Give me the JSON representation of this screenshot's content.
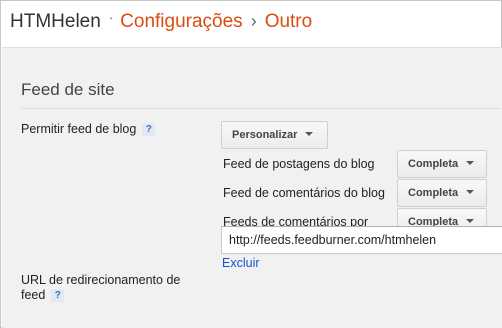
{
  "breadcrumb": {
    "blog_name": "HTMHelen",
    "separator_dot": "·",
    "section": "Configurações",
    "arrow": "›",
    "page": "Outro"
  },
  "feed_section": {
    "title": "Feed de site",
    "allow_label": "Permitir feed de blog",
    "help_glyph": "?",
    "allow_value": "Personalizar",
    "rows": [
      {
        "label": "Feed de postagens do blog",
        "value": "Completa"
      },
      {
        "label": "Feed de comentários do blog",
        "value": "Completa"
      },
      {
        "label": "Feeds de comentários por postagem",
        "value": "Completa"
      }
    ]
  },
  "redirect": {
    "label": "URL de redirecionamento de feed",
    "value": "http://feeds.feedburner.com/htmhelen",
    "remove_label": "Excluir"
  },
  "colors": {
    "accent": "#dd4b0f",
    "link": "#1155cc",
    "panel_bg": "#f1f1f1"
  }
}
